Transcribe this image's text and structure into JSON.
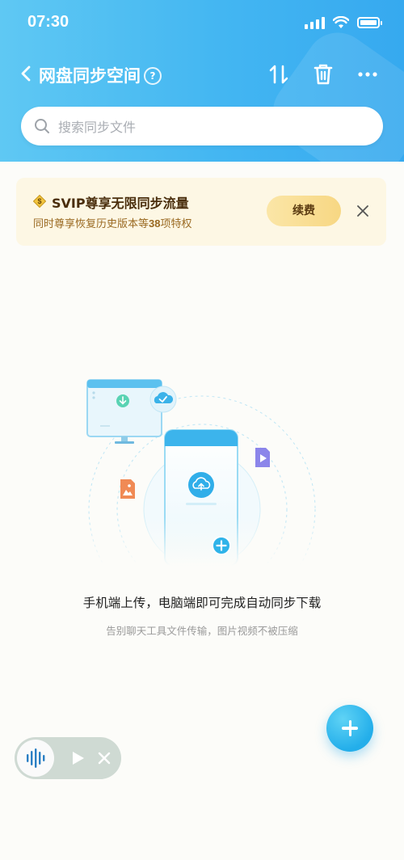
{
  "status_bar": {
    "time": "07:30"
  },
  "nav": {
    "title": "网盘同步空间",
    "help_icon": "?"
  },
  "search": {
    "placeholder": "搜索同步文件"
  },
  "banner": {
    "title": "SVIP尊享无限同步流量",
    "subtitle_prefix": "同时尊享恢复历史版本等",
    "subtitle_count": "38",
    "subtitle_suffix": "项特权",
    "renew_label": "续费"
  },
  "empty_state": {
    "title": "手机端上传，电脑端即可完成自动同步下载",
    "subtitle": "告别聊天工具文件传输，图片视频不被压缩"
  },
  "colors": {
    "header": "#43b6f2",
    "accent": "#23aeea",
    "banner_bg": "#fdf7e4",
    "renew_button": "#f7d783"
  },
  "icons": [
    "back-icon",
    "help-icon",
    "sort-icon",
    "trash-icon",
    "more-icon",
    "search-icon",
    "coin-icon",
    "close-icon",
    "add-icon",
    "audio-wave-icon",
    "play-icon"
  ]
}
